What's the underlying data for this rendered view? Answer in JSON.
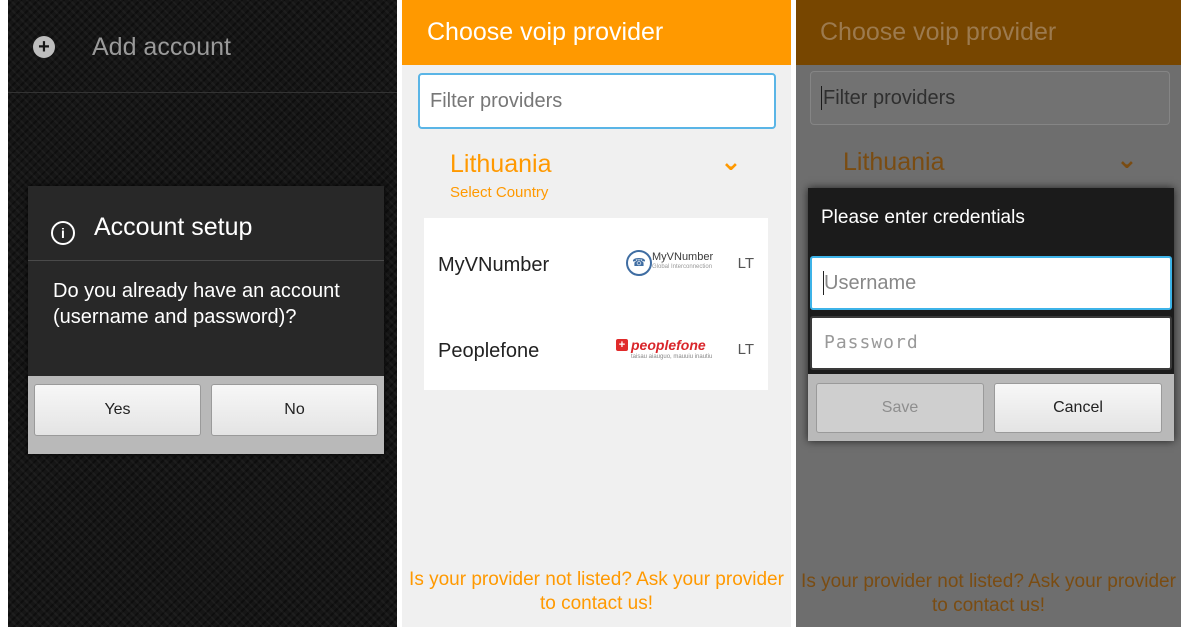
{
  "panel1": {
    "add_account_label": "Add account",
    "dialog": {
      "title": "Account setup",
      "message": "Do you already have an account (username and password)?",
      "yes_label": "Yes",
      "no_label": "No"
    }
  },
  "panel2": {
    "header_title": "Choose voip provider",
    "filter_placeholder": "Filter providers",
    "country": "Lithuania",
    "select_country_label": "Select Country",
    "providers": [
      {
        "name": "MyVNumber",
        "logo_text": "MyVNumber",
        "logo_tagline": "Global Interconnection",
        "country_code": "LT"
      },
      {
        "name": "Peoplefone",
        "logo_text": "peoplefone",
        "logo_tagline": "taisau aiauguo, mauuiu inautiu",
        "country_code": "LT"
      }
    ],
    "footer": "Is your provider not listed? Ask your provider to contact us!"
  },
  "panel3": {
    "header_title": "Choose voip provider",
    "filter_placeholder": "Filter providers",
    "country": "Lithuania",
    "footer": "Is your provider not listed? Ask your provider to contact us!",
    "dialog": {
      "title": "Please enter credentials",
      "username_placeholder": "Username",
      "password_placeholder": "Password",
      "save_label": "Save",
      "cancel_label": "Cancel"
    }
  },
  "colors": {
    "accent_orange": "#ff9900",
    "focus_blue": "#3db3e8",
    "dialog_dark": "#282828"
  },
  "icons": [
    "plus-circle-icon",
    "info-icon",
    "chevron-down-icon",
    "myvnumber-logo",
    "peoplefone-logo"
  ]
}
